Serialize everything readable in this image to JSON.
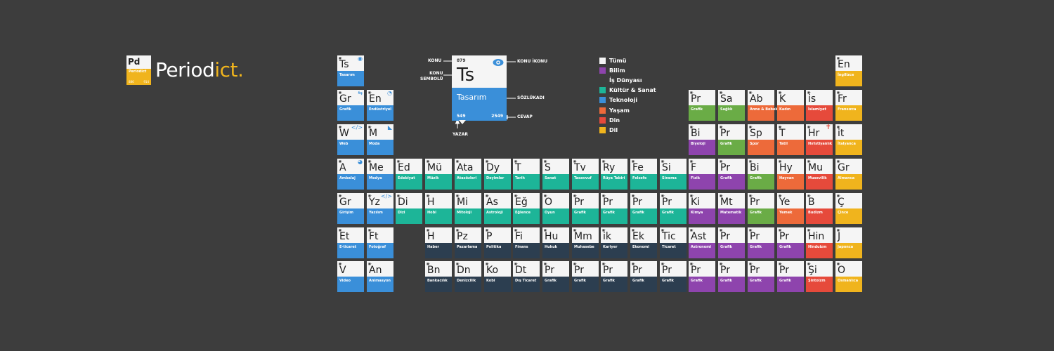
{
  "logo": {
    "tile_symbol": "Pd",
    "tile_name": "Periodict",
    "tile_num_left": "886",
    "tile_num_right": "914",
    "text_main": "Period",
    "text_accent": "ict."
  },
  "colors": {
    "tech": "#3a8fd9",
    "culture": "#1db598",
    "science": "#8e44ad",
    "life": "#6aac46",
    "living": "#ed6a3a",
    "religion": "#e64a3b",
    "language": "#f0b41d",
    "business": "#2c3e50",
    "all": "#f5f5f5"
  },
  "legend": [
    {
      "label": "Tümü",
      "cat": "all"
    },
    {
      "label": "Bilim",
      "cat": "science"
    },
    {
      "label": "İş Dünyası",
      "cat": "business"
    },
    {
      "label": "Kültür & Sanat",
      "cat": "culture"
    },
    {
      "label": "Teknoloji",
      "cat": "tech"
    },
    {
      "label": "Yaşam",
      "cat": "living"
    },
    {
      "label": "Din",
      "cat": "religion"
    },
    {
      "label": "Dil",
      "cat": "language"
    }
  ],
  "key": {
    "number": "879",
    "symbol": "Ts",
    "name": "Tasarım",
    "count_left": "549",
    "count_right": "2549",
    "label_konu": "KONU",
    "label_konu_sembolu": "KONU\nSEMBOLÜ",
    "label_konu_ikonu": "KONU İKONU",
    "label_sozlukadi": "SÖZLÜKADI",
    "label_cevap": "CEVAP",
    "label_yazar": "YAZAR"
  },
  "tiles": [
    {
      "col": 0,
      "row": 0,
      "sym": "Ts",
      "name": "Tasarım",
      "cat": "tech",
      "icon": "◉",
      "icon_name": "eye-icon"
    },
    {
      "col": 0,
      "row": 1,
      "sym": "Gr",
      "name": "Grafik",
      "cat": "tech",
      "icon": "⇆",
      "icon_name": "swap-icon"
    },
    {
      "col": 1,
      "row": 1,
      "sym": "En",
      "name": "Endüstriyel",
      "cat": "tech",
      "icon": "◔",
      "icon_name": "gauge-icon"
    },
    {
      "col": 0,
      "row": 2,
      "sym": "W",
      "name": "Web",
      "cat": "tech",
      "icon": "</>",
      "icon_name": "code-icon"
    },
    {
      "col": 1,
      "row": 2,
      "sym": "M",
      "name": "Moda",
      "cat": "tech",
      "icon": "◣",
      "icon_name": "hanger-icon"
    },
    {
      "col": 0,
      "row": 3,
      "sym": "A",
      "name": "Ambalaj",
      "cat": "tech",
      "icon": "◕",
      "icon_name": "globe-icon"
    },
    {
      "col": 1,
      "row": 3,
      "sym": "Me",
      "name": "Medya",
      "cat": "tech",
      "icon": "",
      "icon_name": ""
    },
    {
      "col": 0,
      "row": 4,
      "sym": "Gr",
      "name": "Girişim",
      "cat": "tech",
      "icon": "",
      "icon_name": ""
    },
    {
      "col": 1,
      "row": 4,
      "sym": "Yz",
      "name": "Yazılım",
      "cat": "tech",
      "icon": "</>",
      "icon_name": "code-icon"
    },
    {
      "col": 0,
      "row": 5,
      "sym": "Et",
      "name": "E-ticaret",
      "cat": "tech",
      "icon": "",
      "icon_name": ""
    },
    {
      "col": 1,
      "row": 5,
      "sym": "Ft",
      "name": "Fotoğraf",
      "cat": "tech",
      "icon": "",
      "icon_name": ""
    },
    {
      "col": 0,
      "row": 6,
      "sym": "V",
      "name": "Video",
      "cat": "tech",
      "icon": "",
      "icon_name": ""
    },
    {
      "col": 1,
      "row": 6,
      "sym": "An",
      "name": "Animasyon",
      "cat": "tech",
      "icon": "",
      "icon_name": ""
    },
    {
      "col": 2,
      "row": 3,
      "sym": "Ed",
      "name": "Edebiyat",
      "cat": "culture"
    },
    {
      "col": 3,
      "row": 3,
      "sym": "Mü",
      "name": "Müzik",
      "cat": "culture"
    },
    {
      "col": 4,
      "row": 3,
      "sym": "Ata",
      "name": "Atasözleri",
      "cat": "culture"
    },
    {
      "col": 5,
      "row": 3,
      "sym": "Dy",
      "name": "Deyimler",
      "cat": "culture"
    },
    {
      "col": 6,
      "row": 3,
      "sym": "T",
      "name": "Tarih",
      "cat": "culture"
    },
    {
      "col": 7,
      "row": 3,
      "sym": "S",
      "name": "Sanat",
      "cat": "culture"
    },
    {
      "col": 8,
      "row": 3,
      "sym": "Tv",
      "name": "Tasavvuf",
      "cat": "culture"
    },
    {
      "col": 9,
      "row": 3,
      "sym": "Ry",
      "name": "Rüya Tabiri",
      "cat": "culture"
    },
    {
      "col": 10,
      "row": 3,
      "sym": "Fe",
      "name": "Felsefe",
      "cat": "culture"
    },
    {
      "col": 11,
      "row": 3,
      "sym": "Si",
      "name": "Sinema",
      "cat": "culture"
    },
    {
      "col": 2,
      "row": 4,
      "sym": "Di",
      "name": "Dizi",
      "cat": "culture"
    },
    {
      "col": 3,
      "row": 4,
      "sym": "H",
      "name": "Hobi",
      "cat": "culture"
    },
    {
      "col": 4,
      "row": 4,
      "sym": "Mi",
      "name": "Mitoloji",
      "cat": "culture"
    },
    {
      "col": 5,
      "row": 4,
      "sym": "As",
      "name": "Astroloji",
      "cat": "culture"
    },
    {
      "col": 6,
      "row": 4,
      "sym": "Eğ",
      "name": "Eğlence",
      "cat": "culture"
    },
    {
      "col": 7,
      "row": 4,
      "sym": "O",
      "name": "Oyun",
      "cat": "culture"
    },
    {
      "col": 8,
      "row": 4,
      "sym": "Pr",
      "name": "Grafik",
      "cat": "culture"
    },
    {
      "col": 9,
      "row": 4,
      "sym": "Pr",
      "name": "Grafik",
      "cat": "culture"
    },
    {
      "col": 10,
      "row": 4,
      "sym": "Pr",
      "name": "Grafik",
      "cat": "culture"
    },
    {
      "col": 11,
      "row": 4,
      "sym": "Pr",
      "name": "Grafik",
      "cat": "culture"
    },
    {
      "col": 3,
      "row": 5,
      "sym": "H",
      "name": "Haber",
      "cat": "business"
    },
    {
      "col": 4,
      "row": 5,
      "sym": "Pz",
      "name": "Pazarlama",
      "cat": "business"
    },
    {
      "col": 5,
      "row": 5,
      "sym": "P",
      "name": "Politika",
      "cat": "business"
    },
    {
      "col": 6,
      "row": 5,
      "sym": "Fi",
      "name": "Finans",
      "cat": "business"
    },
    {
      "col": 7,
      "row": 5,
      "sym": "Hu",
      "name": "Hukuk",
      "cat": "business"
    },
    {
      "col": 8,
      "row": 5,
      "sym": "Mm",
      "name": "Muhasebe",
      "cat": "business"
    },
    {
      "col": 9,
      "row": 5,
      "sym": "ik",
      "name": "Kariyer",
      "cat": "business"
    },
    {
      "col": 10,
      "row": 5,
      "sym": "Ek",
      "name": "Ekonomi",
      "cat": "business"
    },
    {
      "col": 11,
      "row": 5,
      "sym": "Tic",
      "name": "Ticaret",
      "cat": "business"
    },
    {
      "col": 3,
      "row": 6,
      "sym": "Bn",
      "name": "Bankacılık",
      "cat": "business"
    },
    {
      "col": 4,
      "row": 6,
      "sym": "Dn",
      "name": "Denizcilik",
      "cat": "business"
    },
    {
      "col": 5,
      "row": 6,
      "sym": "Ko",
      "name": "Kobi",
      "cat": "business"
    },
    {
      "col": 6,
      "row": 6,
      "sym": "Dt",
      "name": "Dış Ticaret",
      "cat": "business"
    },
    {
      "col": 7,
      "row": 6,
      "sym": "Pr",
      "name": "Grafik",
      "cat": "business"
    },
    {
      "col": 8,
      "row": 6,
      "sym": "Pr",
      "name": "Grafik",
      "cat": "business"
    },
    {
      "col": 9,
      "row": 6,
      "sym": "Pr",
      "name": "Grafik",
      "cat": "business"
    },
    {
      "col": 10,
      "row": 6,
      "sym": "Pr",
      "name": "Grafik",
      "cat": "business"
    },
    {
      "col": 11,
      "row": 6,
      "sym": "Pr",
      "name": "Grafik",
      "cat": "business"
    },
    {
      "col": 12,
      "row": 1,
      "sym": "Pr",
      "name": "Grafik",
      "cat": "life"
    },
    {
      "col": 13,
      "row": 1,
      "sym": "Sa",
      "name": "Sağlık",
      "cat": "life"
    },
    {
      "col": 14,
      "row": 1,
      "sym": "Ab",
      "name": "Anne & Bebek",
      "cat": "living"
    },
    {
      "col": 15,
      "row": 1,
      "sym": "K",
      "name": "Kadın",
      "cat": "living"
    },
    {
      "col": 16,
      "row": 1,
      "sym": "is",
      "name": "İslamiyet",
      "cat": "religion"
    },
    {
      "col": 17,
      "row": 1,
      "sym": "Fr",
      "name": "Fransızca",
      "cat": "language"
    },
    {
      "col": 17,
      "row": 0,
      "sym": "En",
      "name": "İngilizce",
      "cat": "language"
    },
    {
      "col": 12,
      "row": 2,
      "sym": "Bi",
      "name": "Biyoloji",
      "cat": "science"
    },
    {
      "col": 13,
      "row": 2,
      "sym": "Pr",
      "name": "Grafik",
      "cat": "life"
    },
    {
      "col": 14,
      "row": 2,
      "sym": "Sp",
      "name": "Spor",
      "cat": "living"
    },
    {
      "col": 15,
      "row": 2,
      "sym": "T",
      "name": "Tatil",
      "cat": "living"
    },
    {
      "col": 16,
      "row": 2,
      "sym": "Hr",
      "name": "Hıristiyanlık",
      "cat": "religion",
      "icon": "✝",
      "icon_name": "cross-icon",
      "icon_red": true
    },
    {
      "col": 17,
      "row": 2,
      "sym": "it",
      "name": "İtalyanca",
      "cat": "language"
    },
    {
      "col": 12,
      "row": 3,
      "sym": "F",
      "name": "Fizik",
      "cat": "science"
    },
    {
      "col": 13,
      "row": 3,
      "sym": "Pr",
      "name": "Grafik",
      "cat": "science"
    },
    {
      "col": 14,
      "row": 3,
      "sym": "Bi",
      "name": "Grafik",
      "cat": "life"
    },
    {
      "col": 15,
      "row": 3,
      "sym": "Hy",
      "name": "Hayvan",
      "cat": "living"
    },
    {
      "col": 16,
      "row": 3,
      "sym": "Mu",
      "name": "Musevilik",
      "cat": "religion"
    },
    {
      "col": 17,
      "row": 3,
      "sym": "Gr",
      "name": "Almanca",
      "cat": "language"
    },
    {
      "col": 12,
      "row": 4,
      "sym": "Ki",
      "name": "Kimya",
      "cat": "science"
    },
    {
      "col": 13,
      "row": 4,
      "sym": "Mt",
      "name": "Matematik",
      "cat": "science"
    },
    {
      "col": 14,
      "row": 4,
      "sym": "Pr",
      "name": "Grafik",
      "cat": "life"
    },
    {
      "col": 15,
      "row": 4,
      "sym": "Ye",
      "name": "Yemek",
      "cat": "living"
    },
    {
      "col": 16,
      "row": 4,
      "sym": "B",
      "name": "Budizm",
      "cat": "religion"
    },
    {
      "col": 17,
      "row": 4,
      "sym": "Ç",
      "name": "Çince",
      "cat": "language"
    },
    {
      "col": 12,
      "row": 5,
      "sym": "Ast",
      "name": "Astronomi",
      "cat": "science"
    },
    {
      "col": 13,
      "row": 5,
      "sym": "Pr",
      "name": "Grafik",
      "cat": "science"
    },
    {
      "col": 14,
      "row": 5,
      "sym": "Pr",
      "name": "Grafik",
      "cat": "science"
    },
    {
      "col": 15,
      "row": 5,
      "sym": "Pr",
      "name": "Grafik",
      "cat": "science"
    },
    {
      "col": 16,
      "row": 5,
      "sym": "Hin",
      "name": "Hinduizm",
      "cat": "religion"
    },
    {
      "col": 17,
      "row": 5,
      "sym": "J",
      "name": "Japonca",
      "cat": "language"
    },
    {
      "col": 12,
      "row": 6,
      "sym": "Pr",
      "name": "Grafik",
      "cat": "science"
    },
    {
      "col": 13,
      "row": 6,
      "sym": "Pr",
      "name": "Grafik",
      "cat": "science"
    },
    {
      "col": 14,
      "row": 6,
      "sym": "Pr",
      "name": "Grafik",
      "cat": "science"
    },
    {
      "col": 15,
      "row": 6,
      "sym": "Pr",
      "name": "Grafik",
      "cat": "science"
    },
    {
      "col": 16,
      "row": 6,
      "sym": "Şi",
      "name": "Şintoizm",
      "cat": "religion"
    },
    {
      "col": 17,
      "row": 6,
      "sym": "O",
      "name": "Osmanlıca",
      "cat": "language"
    }
  ]
}
